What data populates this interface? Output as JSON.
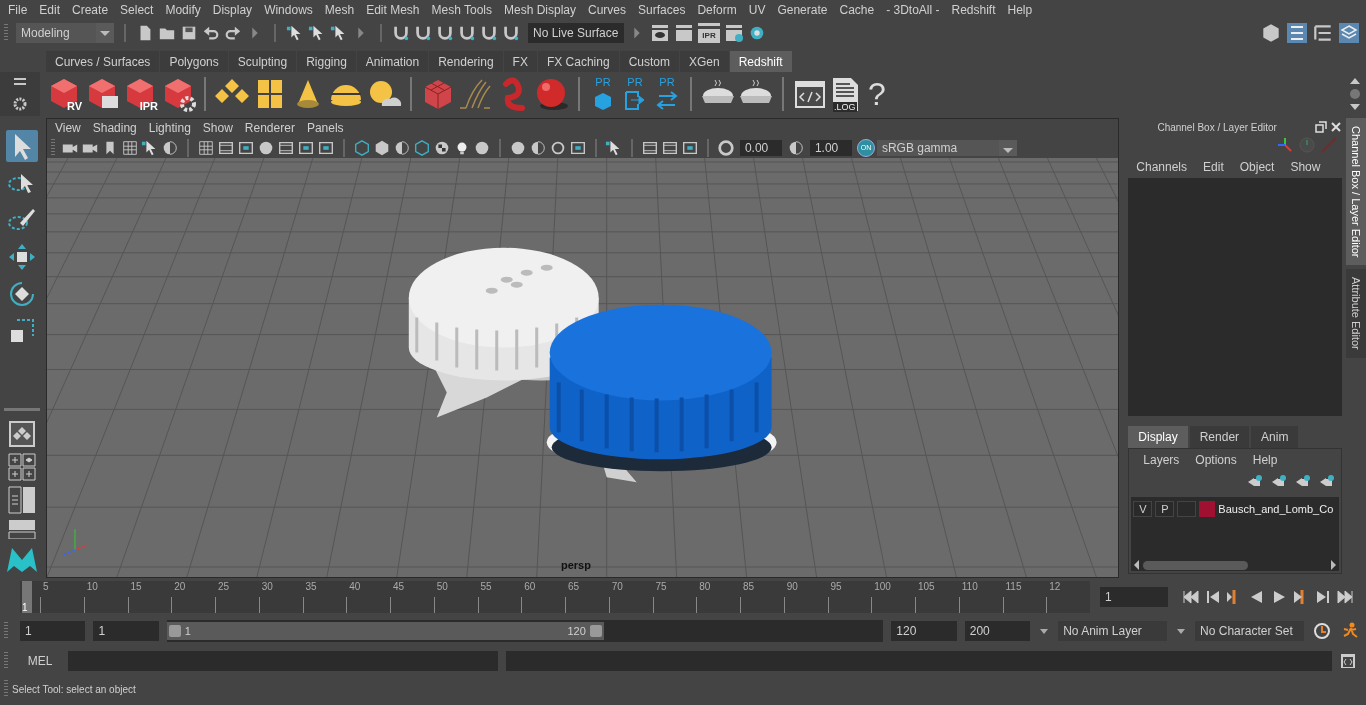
{
  "menu_bar": [
    "File",
    "Edit",
    "Create",
    "Select",
    "Modify",
    "Display",
    "Windows",
    "Mesh",
    "Edit Mesh",
    "Mesh Tools",
    "Mesh Display",
    "Curves",
    "Surfaces",
    "Deform",
    "UV",
    "Generate",
    "Cache",
    "- 3DtoAll -",
    "Redshift",
    "Help"
  ],
  "status_line": {
    "workspace": "Modeling",
    "live_surface": "No Live Surface",
    "render_buttons": [
      {
        "kind": "eye"
      },
      {
        "kind": "plain"
      },
      {
        "kind": "label",
        "label": "IPR"
      },
      {
        "kind": "gear"
      },
      {
        "kind": "ring"
      }
    ]
  },
  "shelf_tabs": [
    {
      "label": "Curves / Surfaces",
      "selected": false
    },
    {
      "label": "Polygons",
      "selected": false
    },
    {
      "label": "Sculpting",
      "selected": false
    },
    {
      "label": "Rigging",
      "selected": false
    },
    {
      "label": "Animation",
      "selected": false
    },
    {
      "label": "Rendering",
      "selected": false
    },
    {
      "label": "FX",
      "selected": false
    },
    {
      "label": "FX Caching",
      "selected": false
    },
    {
      "label": "Custom",
      "selected": false
    },
    {
      "label": "XGen",
      "selected": false
    },
    {
      "label": "Redshift",
      "selected": true
    }
  ],
  "shelf": [
    {
      "kind": "rs-cube",
      "label": "RV"
    },
    {
      "kind": "rs-cube-clapper"
    },
    {
      "kind": "rs-cube",
      "label": "IPR"
    },
    {
      "kind": "rs-cube-gear"
    },
    {
      "kind": "separator"
    },
    {
      "kind": "diamonds"
    },
    {
      "kind": "tiles"
    },
    {
      "kind": "cone"
    },
    {
      "kind": "dome"
    },
    {
      "kind": "sun"
    },
    {
      "kind": "separator"
    },
    {
      "kind": "cube-grid"
    },
    {
      "kind": "hair"
    },
    {
      "kind": "squiggle"
    },
    {
      "kind": "ball"
    },
    {
      "kind": "separator"
    },
    {
      "kind": "pr-box",
      "label": "PR"
    },
    {
      "kind": "pr-export",
      "label": "PR"
    },
    {
      "kind": "pr-swap",
      "label": "PR"
    },
    {
      "kind": "separator"
    },
    {
      "kind": "pie"
    },
    {
      "kind": "pie"
    },
    {
      "kind": "separator"
    },
    {
      "kind": "code"
    },
    {
      "kind": "log",
      "label": ".LOG"
    },
    {
      "kind": "help",
      "label": "?"
    }
  ],
  "tools": [
    {
      "kind": "select",
      "selected": true
    },
    {
      "kind": "lasso",
      "selected": false
    },
    {
      "kind": "paint",
      "selected": false
    },
    {
      "kind": "move",
      "selected": false
    },
    {
      "kind": "rotate",
      "selected": false
    },
    {
      "kind": "scale",
      "selected": false
    }
  ],
  "viewport": {
    "menu": [
      "View",
      "Shading",
      "Lighting",
      "Show",
      "Renderer",
      "Panels"
    ],
    "exposure": "0.00",
    "gamma": "1.00",
    "view_transform_badge": "ON",
    "color_space": "sRGB gamma",
    "camera": "persp"
  },
  "channel_box": {
    "title": "Channel Box / Layer Editor",
    "menu": [
      "Channels",
      "Edit",
      "Object",
      "Show"
    ]
  },
  "layer_editor": {
    "tabs": [
      {
        "label": "Display",
        "selected": true
      },
      {
        "label": "Render",
        "selected": false
      },
      {
        "label": "Anim",
        "selected": false
      }
    ],
    "menu": [
      "Layers",
      "Options",
      "Help"
    ],
    "layers": [
      {
        "visibility": "V",
        "playback": "P",
        "color": "#a01030",
        "name": "Bausch_and_Lomb_Co"
      }
    ]
  },
  "side_tabs": [
    {
      "label": "Channel Box / Layer Editor",
      "selected": true
    },
    {
      "label": "Attribute Editor",
      "selected": false
    }
  ],
  "timeline": {
    "ticks": [
      "5",
      "10",
      "15",
      "20",
      "25",
      "30",
      "35",
      "40",
      "45",
      "50",
      "55",
      "60",
      "65",
      "70",
      "75",
      "80",
      "85",
      "90",
      "95",
      "100",
      "105",
      "110",
      "115",
      "12"
    ],
    "current_frame": "1",
    "frame_field": "1",
    "level": 0
  },
  "range": {
    "start": "1",
    "playback_start": "1",
    "slider_start": "1",
    "slider_end": "120",
    "playback_end": "120",
    "end": "200",
    "level": 0.61,
    "anim_layer": "No Anim Layer",
    "character_set": "No Character Set"
  },
  "command_line": {
    "label": "MEL"
  },
  "help_line": "Select Tool: select an object"
}
